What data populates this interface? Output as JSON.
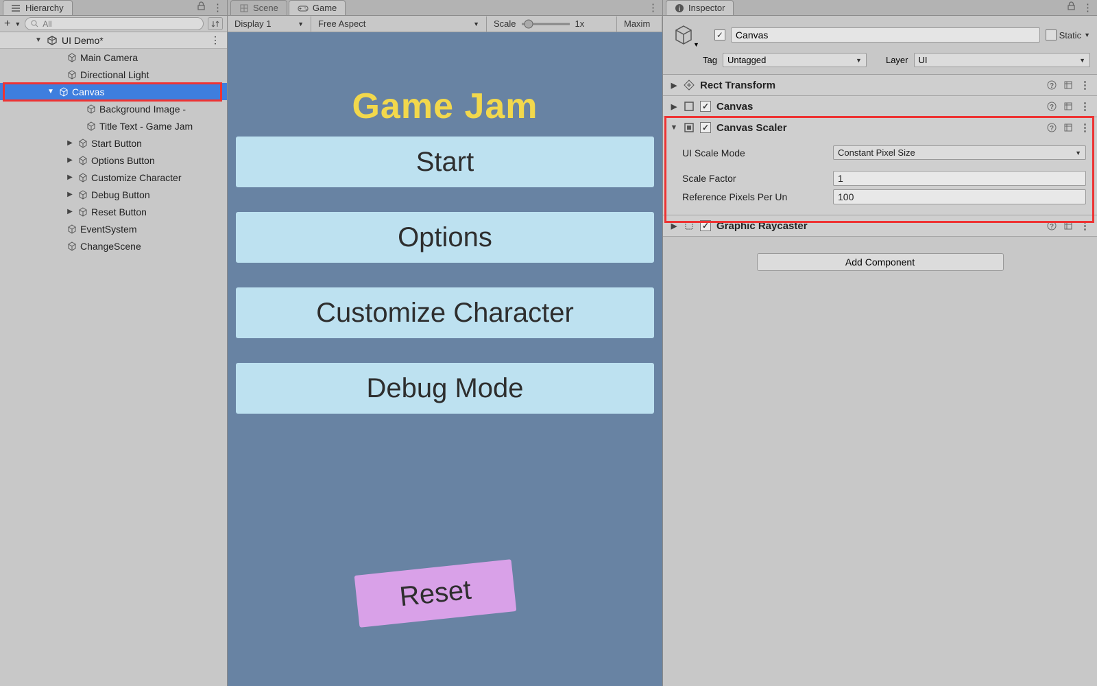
{
  "hierarchy": {
    "tab": "Hierarchy",
    "search_placeholder": "All",
    "scene": "UI Demo*",
    "nodes": {
      "main_camera": "Main Camera",
      "dir_light": "Directional Light",
      "canvas": "Canvas",
      "bg": "Background Image -",
      "title": "Title Text - Game Jam",
      "start": "Start Button",
      "options": "Options Button",
      "customize": "Customize Character",
      "debug": "Debug Button",
      "reset": "Reset Button",
      "es": "EventSystem",
      "cs": "ChangeScene"
    }
  },
  "center": {
    "tab_scene": "Scene",
    "tab_game": "Game",
    "display": "Display 1",
    "aspect": "Free Aspect",
    "scale_label": "Scale",
    "scale_value": "1x",
    "maximize": "Maxim"
  },
  "game": {
    "title": "Game Jam",
    "b1": "Start",
    "b2": "Options",
    "b3": "Customize Character",
    "b4": "Debug Mode",
    "b5": "Reset"
  },
  "inspector": {
    "tab": "Inspector",
    "name": "Canvas",
    "static": "Static",
    "tag_label": "Tag",
    "tag_value": "Untagged",
    "layer_label": "Layer",
    "layer_value": "UI",
    "comp_rect": "Rect Transform",
    "comp_canvas": "Canvas",
    "comp_scaler": "Canvas Scaler",
    "comp_ray": "Graphic Raycaster",
    "scaler": {
      "mode_label": "UI Scale Mode",
      "mode_value": "Constant Pixel Size",
      "sf_label": "Scale Factor",
      "sf_value": "1",
      "rpu_label": "Reference Pixels Per Un",
      "rpu_value": "100"
    },
    "add_component": "Add Component"
  }
}
